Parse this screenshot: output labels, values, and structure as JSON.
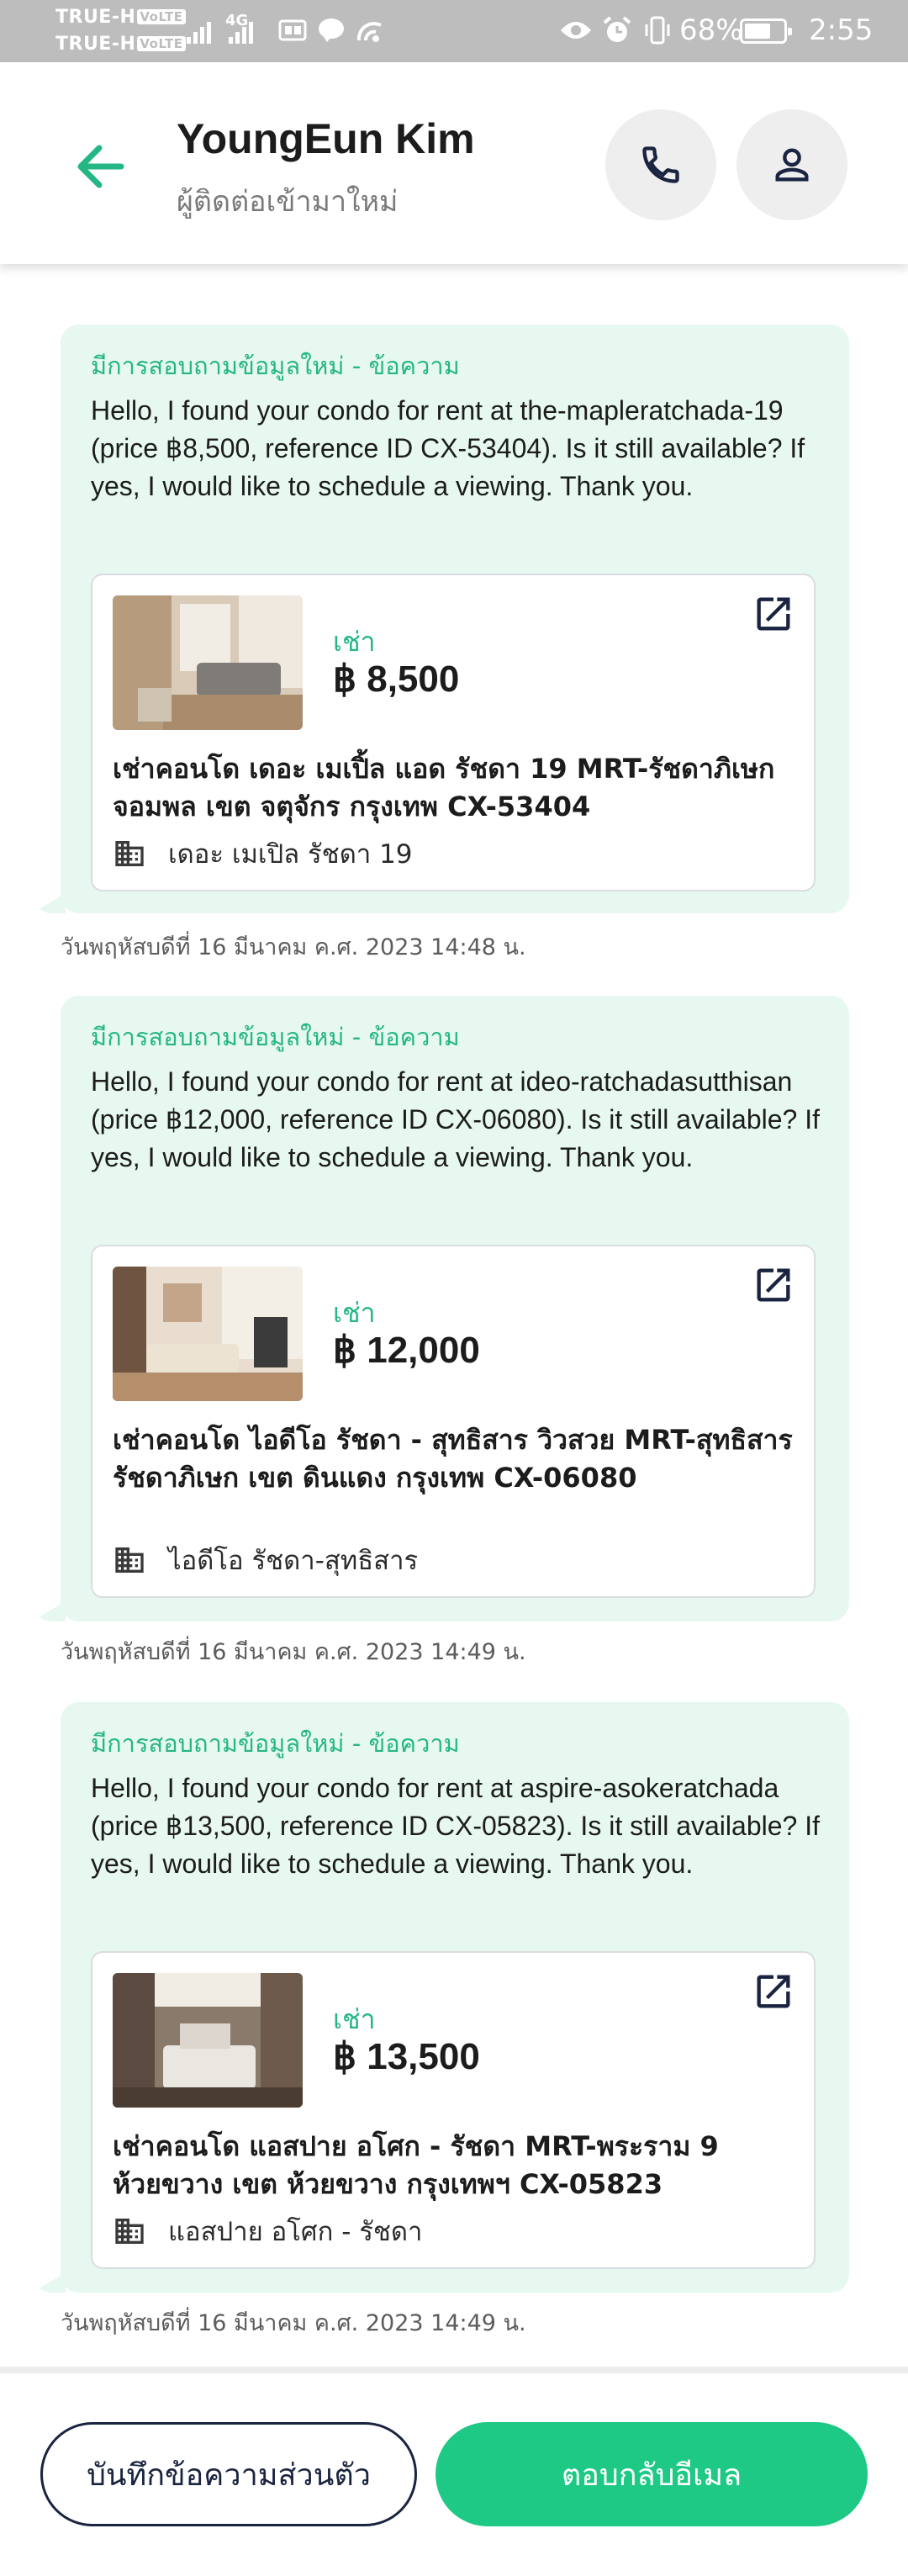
{
  "status_bar": {
    "carrier_1": "TRUE-H",
    "carrier_2": "TRUE-H",
    "volte_badge": "VoLTE",
    "network": "4G",
    "battery_percent": "68%",
    "battery_level": 0.68,
    "time": "2:55"
  },
  "header": {
    "title": "YoungEun Kim",
    "subtitle": "ผู้ติดต่อเข้ามาใหม่",
    "back_icon": "arrow-left-icon",
    "call_icon": "phone-icon",
    "contact_icon": "person-icon",
    "accent_color": "#25b783"
  },
  "messages": [
    {
      "heading": "มีการสอบถามข้อมูลใหม่ - ข้อความ",
      "body": "Hello, I found your condo for rent at the-mapleratchada-19 (price ฿8,500, reference ID CX-53404). Is it still available? If yes, I would like to schedule a viewing. Thank you.",
      "listing": {
        "type_label": "เช่า",
        "price": "฿ 8,500",
        "title": "เช่าคอนโด  เดอะ เมเปิ้ล แอด รัชดา 19 MRT-รัชดาภิเษก จอมพล  เขต จตุจักร กรุงเทพ CX-53404",
        "building": "เดอะ เมเปิล รัชดา 19"
      },
      "timestamp": "วันพฤหัสบดีที่ 16 มีนาคม ค.ศ. 2023 14:48 น."
    },
    {
      "heading": "มีการสอบถามข้อมูลใหม่ - ข้อความ",
      "body": "Hello, I found your condo for rent at ideo-ratchadasutthisan (price ฿12,000, reference ID CX-06080). Is it still available? If yes, I would like to schedule a viewing. Thank you.",
      "listing": {
        "type_label": "เช่า",
        "price": "฿ 12,000",
        "title": "เช่าคอนโด  ไอดีโอ รัชดา - สุทธิสาร วิวสวย MRT-สุทธิสาร รัชดาภิเษก เขต ดินแดง กรุงเทพ CX-06080",
        "building": "ไอดีโอ รัชดา-สุทธิสาร"
      },
      "timestamp": "วันพฤหัสบดีที่ 16 มีนาคม ค.ศ. 2023 14:49 น."
    },
    {
      "heading": "มีการสอบถามข้อมูลใหม่ - ข้อความ",
      "body": "Hello, I found your condo for rent at aspire-asokeratchada (price ฿13,500, reference ID CX-05823). Is it still available? If yes, I would like to schedule a viewing. Thank you.",
      "listing": {
        "type_label": "เช่า",
        "price": "฿ 13,500",
        "title": "เช่าคอนโด แอสปาย อโศก - รัชดา MRT-พระราม 9 ห้วยขวาง เขต ห้วยขวาง กรุงเทพฯ CX-05823",
        "building": "แอสปาย อโศก - รัชดา"
      },
      "timestamp": "วันพฤหัสบดีที่ 16 มีนาคม ค.ศ. 2023 14:49 น."
    }
  ],
  "footer": {
    "note_button": "บันทึกข้อความส่วนตัว",
    "reply_button": "ตอบกลับอีเมล",
    "reply_color": "#1dc985"
  }
}
